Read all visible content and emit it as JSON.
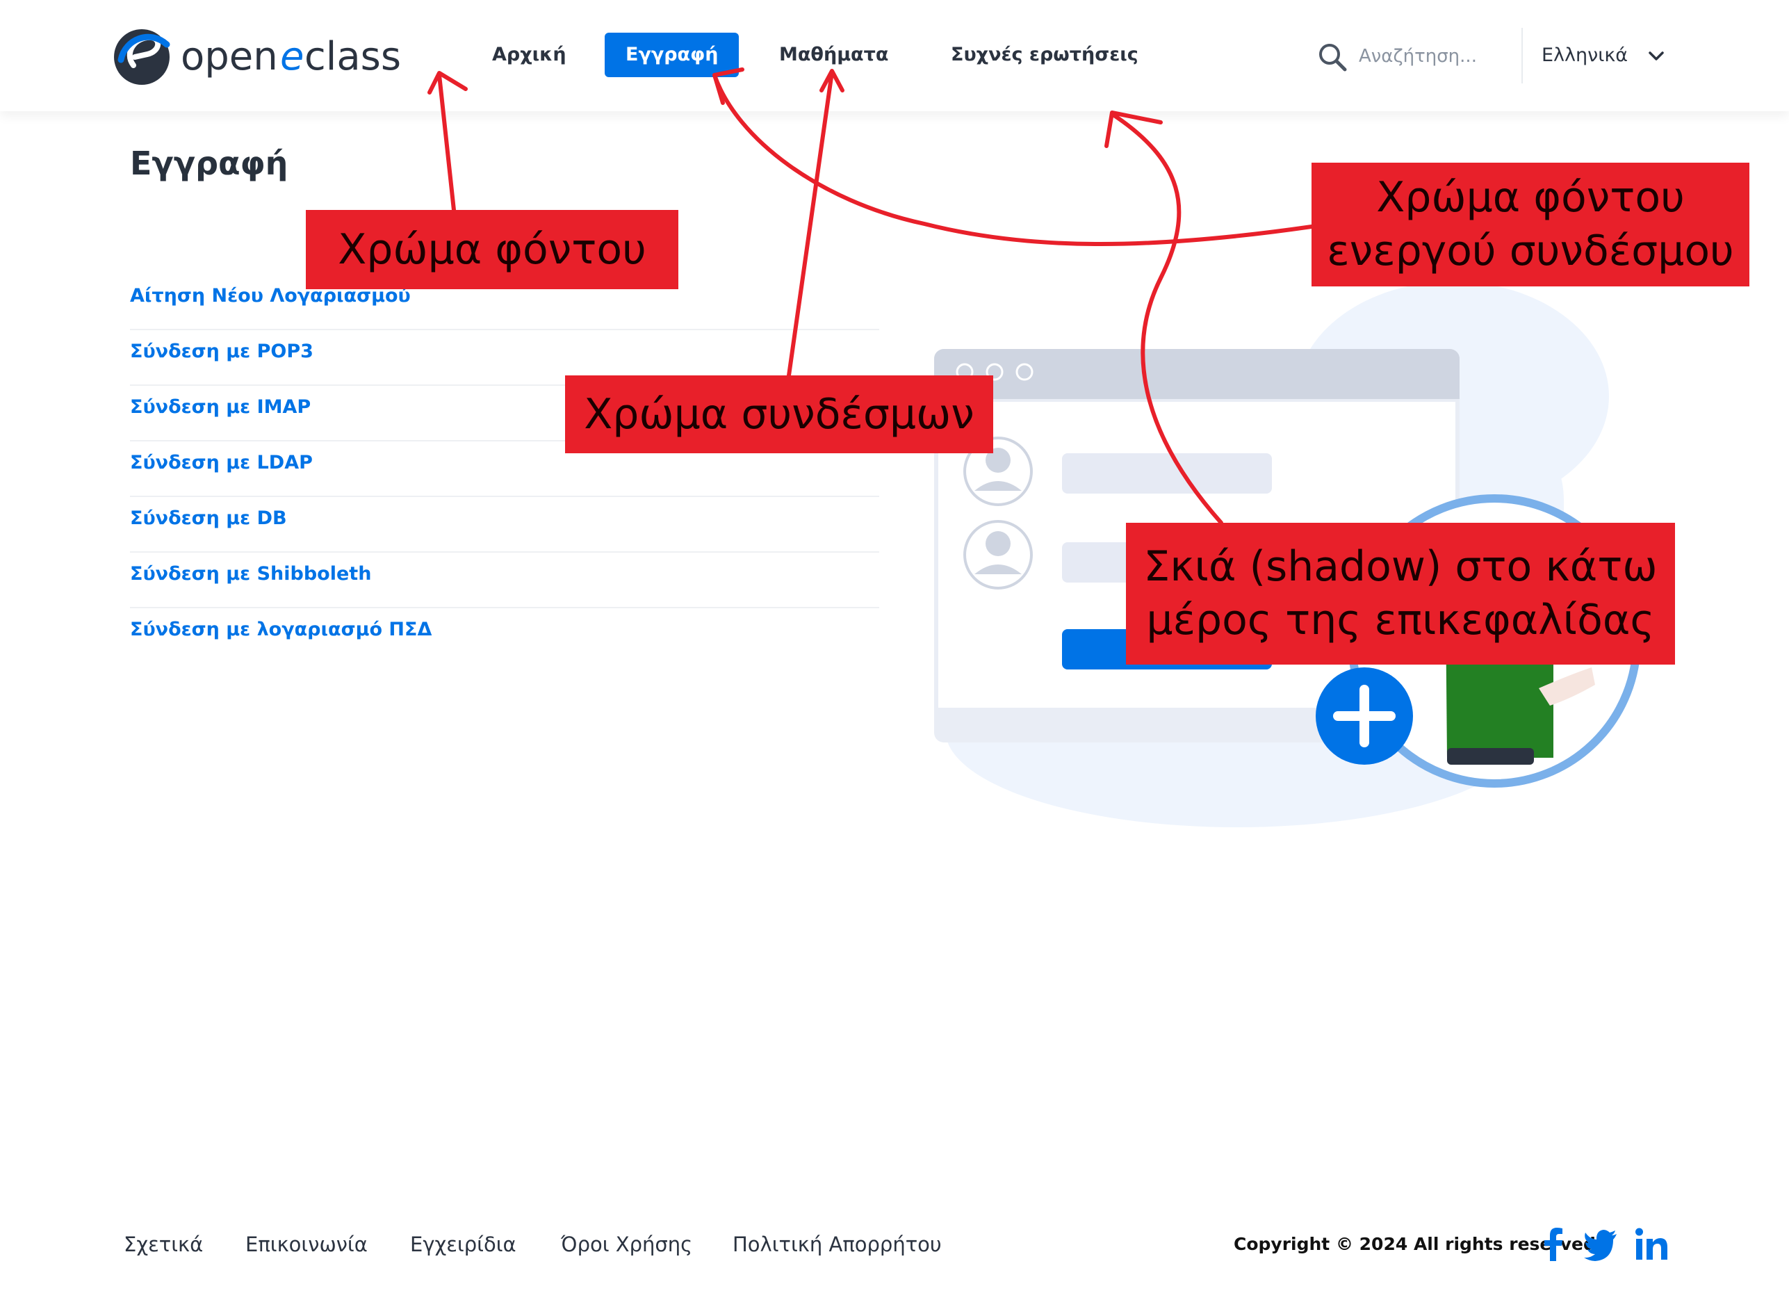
{
  "header": {
    "logo": {
      "word1": "open",
      "word2": "eclass",
      "colors": {
        "dark": "#2b3340",
        "blue": "#0073e6"
      }
    },
    "nav": [
      {
        "label": "Αρχική",
        "active": false
      },
      {
        "label": "Εγγραφή",
        "active": true
      },
      {
        "label": "Μαθήματα",
        "active": false
      },
      {
        "label": "Συχνές ερωτήσεις",
        "active": false
      }
    ],
    "search": {
      "icon": "search-icon",
      "placeholder": "Αναζήτηση..."
    },
    "language": {
      "value": "Ελληνικά",
      "icon": "chevron-down-icon"
    }
  },
  "main": {
    "title": "Εγγραφή",
    "auth_options": [
      "Αίτηση Νέου Λογαριασμού",
      "Σύνδεση με POP3",
      "Σύνδεση με IMAP",
      "Σύνδεση με LDAP",
      "Σύνδεση με DB",
      "Σύνδεση με Shibboleth",
      "Σύνδεση με λογαριασμό ΠΣΔ"
    ]
  },
  "footer": {
    "links": [
      "Σχετικά",
      "Επικοινωνία",
      "Εγχειρίδια",
      "Όροι Χρήσης",
      "Πολιτική Απορρήτου"
    ],
    "copyright": "Copyright © 2024 All rights reserved",
    "social": [
      "facebook-icon",
      "twitter-icon",
      "linkedin-icon"
    ]
  },
  "annotations": [
    {
      "lines": [
        "Χρώμα φόντου"
      ]
    },
    {
      "lines": [
        "Χρώμα φόντου",
        "ενεργού συνδέσμου"
      ]
    },
    {
      "lines": [
        "Χρώμα συνδέσμων"
      ]
    },
    {
      "lines": [
        "Σκιά (shadow) στο κάτω",
        "μέρος της επικεφαλίδας"
      ]
    }
  ],
  "colors": {
    "accent": "#0073e6",
    "annotation": "#e8202a",
    "text": "#2b3340"
  }
}
